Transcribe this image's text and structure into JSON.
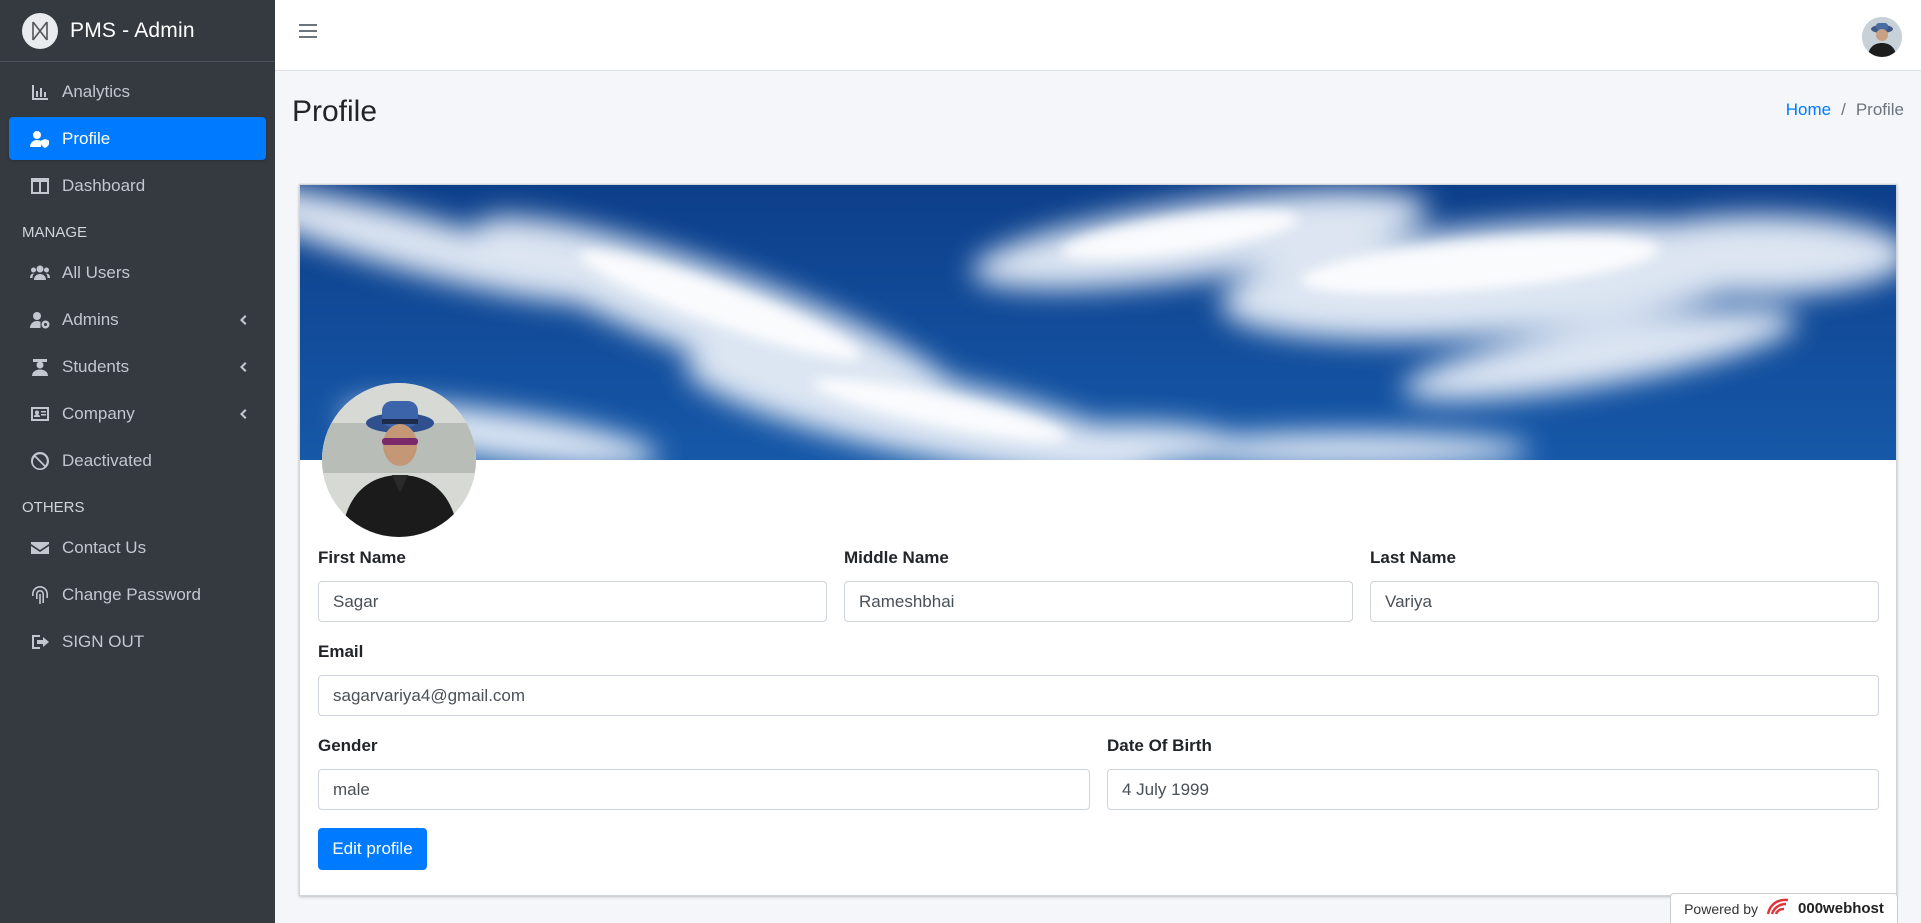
{
  "brand": {
    "name": "PMS - Admin"
  },
  "sidebar": {
    "items": [
      {
        "label": "Analytics",
        "icon": "chart-bar-icon"
      },
      {
        "label": "Profile",
        "icon": "user-shield-icon",
        "active": true
      },
      {
        "label": "Dashboard",
        "icon": "columns-icon"
      }
    ],
    "manage_header": "MANAGE",
    "manage": [
      {
        "label": "All Users",
        "icon": "users-icon"
      },
      {
        "label": "Admins",
        "icon": "user-cog-icon",
        "has_submenu": true
      },
      {
        "label": "Students",
        "icon": "graduate-icon",
        "has_submenu": true
      },
      {
        "label": "Company",
        "icon": "id-card-icon",
        "has_submenu": true
      },
      {
        "label": "Deactivated",
        "icon": "ban-icon"
      }
    ],
    "others_header": "OTHERS",
    "others": [
      {
        "label": "Contact Us",
        "icon": "envelope-icon"
      },
      {
        "label": "Change Password",
        "icon": "fingerprint-icon"
      },
      {
        "label": "SIGN OUT",
        "icon": "sign-out-icon"
      }
    ]
  },
  "header": {
    "title": "Profile"
  },
  "breadcrumb": {
    "home": "Home",
    "separator": "/",
    "current": "Profile"
  },
  "profile": {
    "first_name_label": "First Name",
    "first_name": "Sagar",
    "middle_name_label": "Middle Name",
    "middle_name": "Rameshbhai",
    "last_name_label": "Last Name",
    "last_name": "Variya",
    "email_label": "Email",
    "email": "sagarvariya4@gmail.com",
    "gender_label": "Gender",
    "gender": "male",
    "dob_label": "Date Of Birth",
    "dob": "4 July 1999",
    "edit_button": "Edit profile"
  },
  "footer": {
    "powered_by": "Powered by",
    "host": "000webhost"
  },
  "colors": {
    "sidebar_bg": "#343a40",
    "accent": "#007bff",
    "content_bg": "#f4f6f9"
  }
}
